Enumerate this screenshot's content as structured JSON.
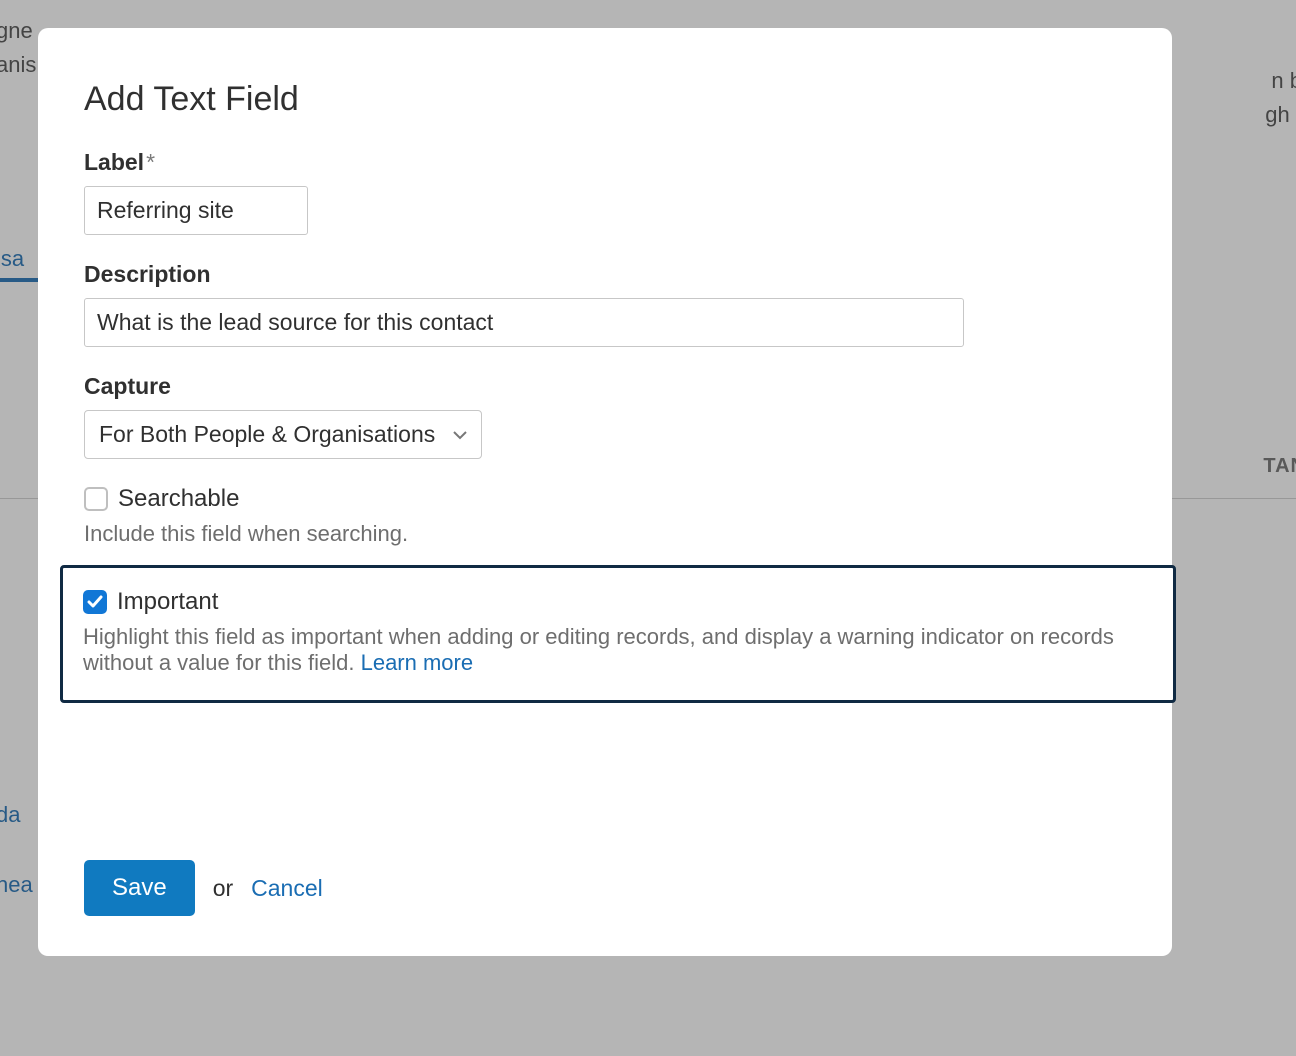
{
  "background": {
    "frag_top_left_1": "gne",
    "frag_top_left_2": "anis",
    "frag_top_right_1": "n b",
    "frag_top_right_2": "gh t",
    "tab_frag": "isa",
    "badge_frag": "TAN",
    "link_frag_1": "da",
    "link_frag_2": "hea"
  },
  "modal": {
    "title": "Add Text Field",
    "label": {
      "label": "Label",
      "required_mark": "*",
      "value": "Referring site"
    },
    "description": {
      "label": "Description",
      "value": "What is the lead source for this contact"
    },
    "capture": {
      "label": "Capture",
      "selected": "For Both People & Organisations"
    },
    "searchable": {
      "label": "Searchable",
      "hint": "Include this field when searching.",
      "checked": false
    },
    "important": {
      "label": "Important",
      "hint": "Highlight this field as important when adding or editing records, and display a warning indicator on records without a value for this field. ",
      "learn_more": "Learn more",
      "checked": true
    },
    "footer": {
      "save": "Save",
      "or": "or",
      "cancel": "Cancel"
    }
  }
}
